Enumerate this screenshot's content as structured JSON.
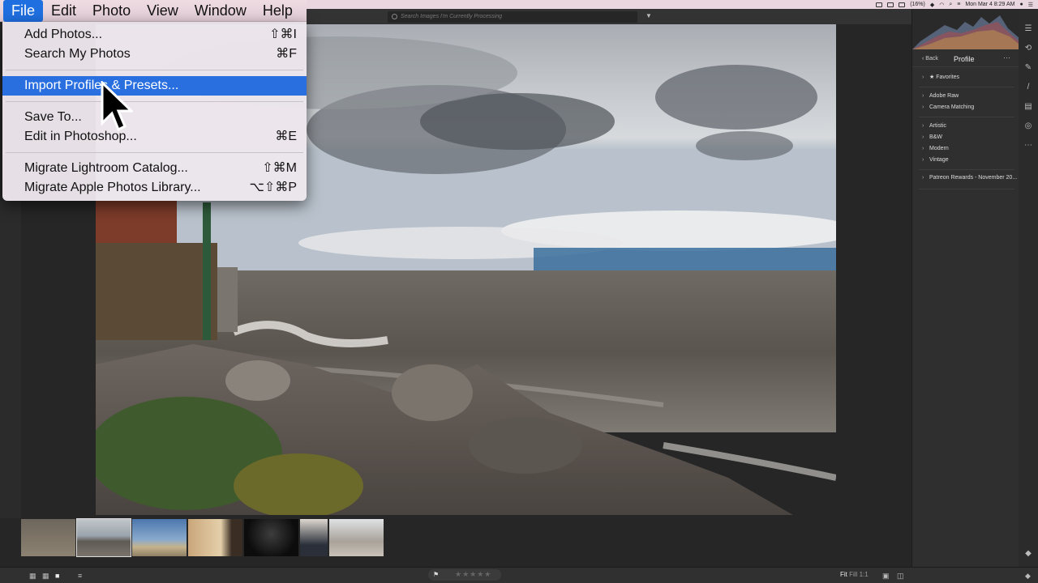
{
  "os_menubar": {
    "datetime": "Mon Mar 4  8:29 AM",
    "battery": "(16%)"
  },
  "app_menu": {
    "items": [
      {
        "label": "File",
        "active": true
      },
      {
        "label": "Edit"
      },
      {
        "label": "Photo"
      },
      {
        "label": "View"
      },
      {
        "label": "Window"
      },
      {
        "label": "Help"
      }
    ]
  },
  "file_menu": {
    "items": [
      {
        "label": "Add Photos...",
        "shortcut": "⇧⌘I"
      },
      {
        "label": "Search My Photos",
        "shortcut": "⌘F"
      },
      {
        "label": "Import Profiles & Presets...",
        "shortcut": "",
        "highlighted": true
      },
      {
        "label": "Save To...",
        "shortcut": ""
      },
      {
        "label": "Edit in Photoshop...",
        "shortcut": "⌘E"
      },
      {
        "label": "Migrate Lightroom Catalog...",
        "shortcut": "⇧⌘M"
      },
      {
        "label": "Migrate Apple Photos Library...",
        "shortcut": "⌥⇧⌘P"
      }
    ]
  },
  "toolbar": {
    "search_placeholder": "Search Images I'm Currently Processing"
  },
  "profile_panel": {
    "back_label": "Back",
    "title": "Profile",
    "more_label": "···",
    "groups": [
      [
        "★ Favorites"
      ],
      [
        "Adobe Raw",
        "Camera Matching"
      ],
      [
        "Artistic",
        "B&W",
        "Modern",
        "Vintage"
      ],
      [
        "Patreon Rewards - November 20..."
      ]
    ]
  },
  "bottombar": {
    "stars": "★★★★★",
    "zoom_fit": "Fit",
    "zoom_fill": "Fill",
    "zoom_1to1": "1:1"
  },
  "colors": {
    "menu_highlight": "#2a6fe0",
    "panel_bg": "#2f2f2f",
    "canvas_bg": "#262626"
  }
}
